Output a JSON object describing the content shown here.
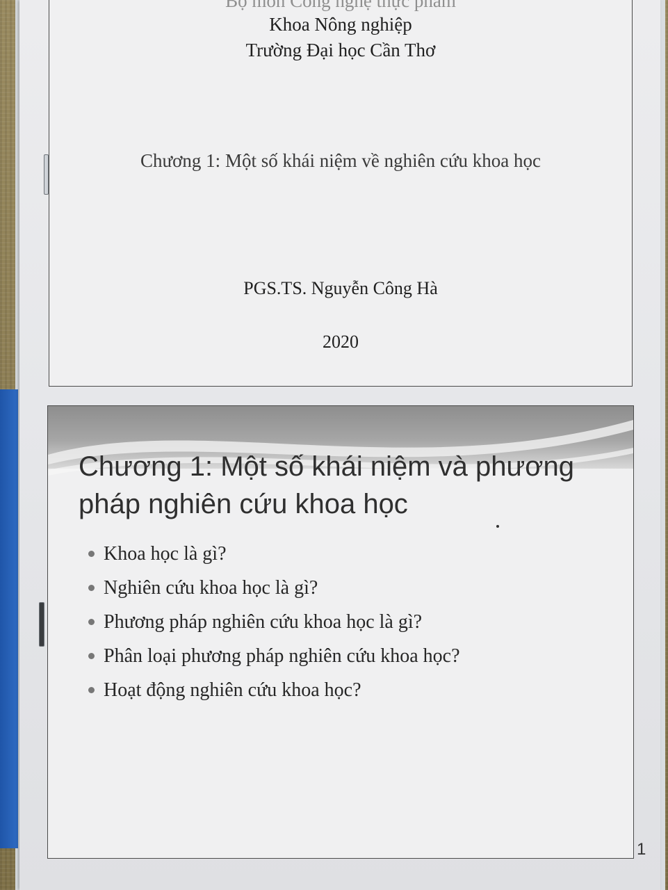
{
  "slide1": {
    "department": "Bộ môn Công nghệ thực phẩm",
    "faculty": "Khoa Nông nghiệp",
    "university": "Trường Đại học Cần Thơ",
    "chapter": "Chương 1: Một số khái niệm về nghiên cứu khoa học",
    "author": "PGS.TS. Nguyễn Công Hà",
    "year": "2020"
  },
  "slide2": {
    "title": "Chương 1: Một số khái niệm và phương pháp nghiên cứu khoa học",
    "bullets": [
      "Khoa học là gì?",
      "Nghiên cứu khoa học là gì?",
      "Phương pháp nghiên cứu khoa học là gì?",
      "Phân loại phương pháp nghiên cứu khoa học?",
      "Hoạt động nghiên cứu khoa học?"
    ]
  },
  "page_number": "1"
}
